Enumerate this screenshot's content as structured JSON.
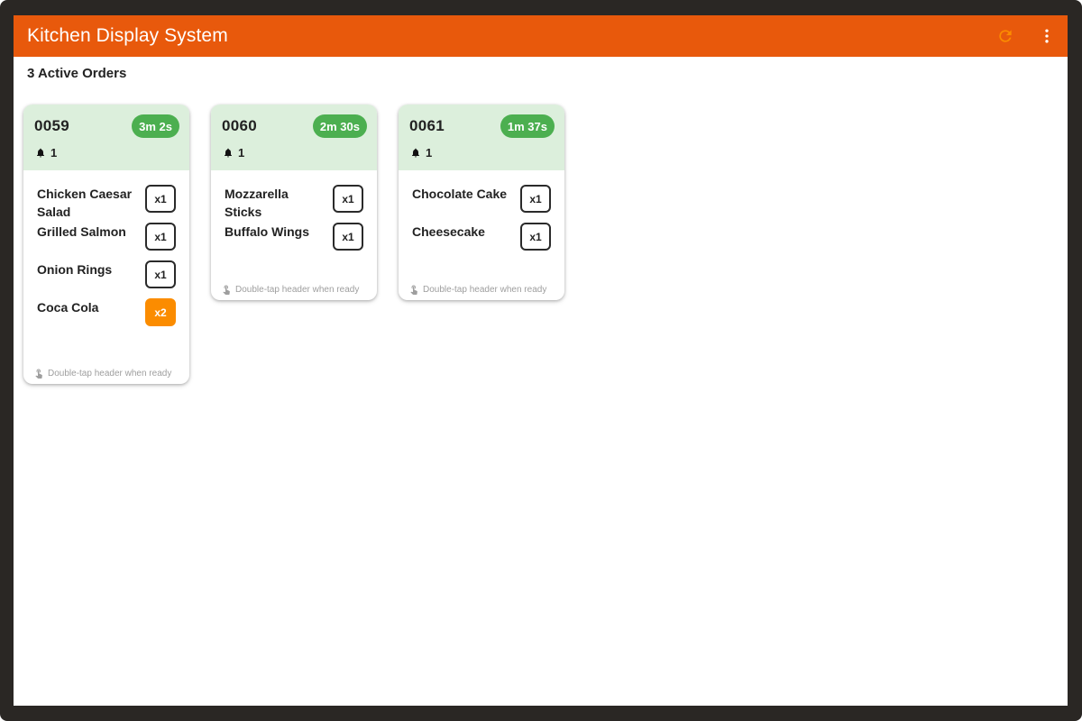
{
  "app": {
    "title": "Kitchen Display System",
    "refresh_icon": "refresh-icon",
    "menu_icon": "more-vert-icon",
    "brand_color": "#e8590c",
    "refresh_color": "#fb8c00"
  },
  "summary": {
    "text": "3 Active Orders"
  },
  "orders": [
    {
      "number": "0059",
      "timer": "3m 2s",
      "bell_count": "1",
      "footer": "Double-tap header when ready",
      "items": [
        {
          "name": "Chicken Caesar Salad",
          "qty": "x1",
          "highlight": false
        },
        {
          "name": "Grilled Salmon",
          "qty": "x1",
          "highlight": false
        },
        {
          "name": "Onion Rings",
          "qty": "x1",
          "highlight": false
        },
        {
          "name": "Coca Cola",
          "qty": "x2",
          "highlight": true
        }
      ]
    },
    {
      "number": "0060",
      "timer": "2m 30s",
      "bell_count": "1",
      "footer": "Double-tap header when ready",
      "items": [
        {
          "name": "Mozzarella Sticks",
          "qty": "x1",
          "highlight": false
        },
        {
          "name": "Buffalo Wings",
          "qty": "x1",
          "highlight": false
        }
      ]
    },
    {
      "number": "0061",
      "timer": "1m 37s",
      "bell_count": "1",
      "footer": "Double-tap header when ready",
      "items": [
        {
          "name": "Chocolate Cake",
          "qty": "x1",
          "highlight": false
        },
        {
          "name": "Cheesecake",
          "qty": "x1",
          "highlight": false
        }
      ]
    }
  ],
  "colors": {
    "header_bg": "#dcefdc",
    "timer_bg": "#4caf50",
    "qty_highlight": "#fb8c00"
  }
}
